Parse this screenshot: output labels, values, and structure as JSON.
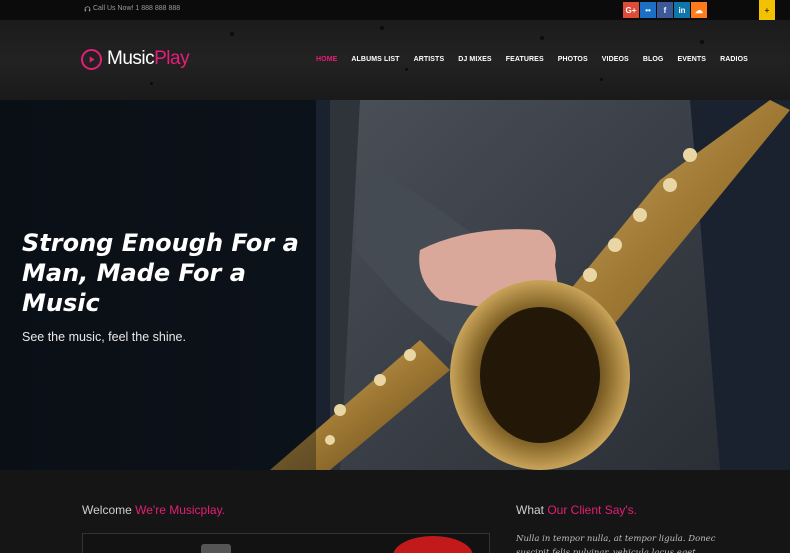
{
  "topbar": {
    "call_text": "Call Us Now! 1 888 888 888",
    "social": [
      {
        "icon": "google-plus-icon",
        "glyph": "G+",
        "color": "#dd4b39"
      },
      {
        "icon": "flickr-icon",
        "glyph": "••",
        "color": "#1b6fc4"
      },
      {
        "icon": "facebook-icon",
        "glyph": "f",
        "color": "#3b5998"
      },
      {
        "icon": "linkedin-icon",
        "glyph": "in",
        "color": "#0e76a8"
      },
      {
        "icon": "soundcloud-icon",
        "glyph": "☁",
        "color": "#ff7a1a"
      }
    ],
    "ribbon_glyph": "+"
  },
  "header": {
    "logo_music": "Music",
    "logo_play": "Play",
    "nav": [
      "HOME",
      "ALBUMS LIST",
      "ARTISTS",
      "DJ MIXES",
      "FEATURES",
      "PHOTOS",
      "VIDEOS",
      "BLOG",
      "EVENTS",
      "RADIOS"
    ]
  },
  "hero": {
    "title": "Strong Enough For a Man, Made For a Music",
    "subtitle": "See the music, feel the shine."
  },
  "welcome": {
    "prefix": "Welcome ",
    "accent": "We're Musicplay."
  },
  "client": {
    "prefix": "What ",
    "accent": "Our Client Say's.",
    "quote": "Nulla in tempor nulla, at tempor ligula. Donec suscipit felis pulvinar, vehicula lacus eget"
  },
  "colors": {
    "accent": "#e51e78",
    "background": "#141414"
  }
}
